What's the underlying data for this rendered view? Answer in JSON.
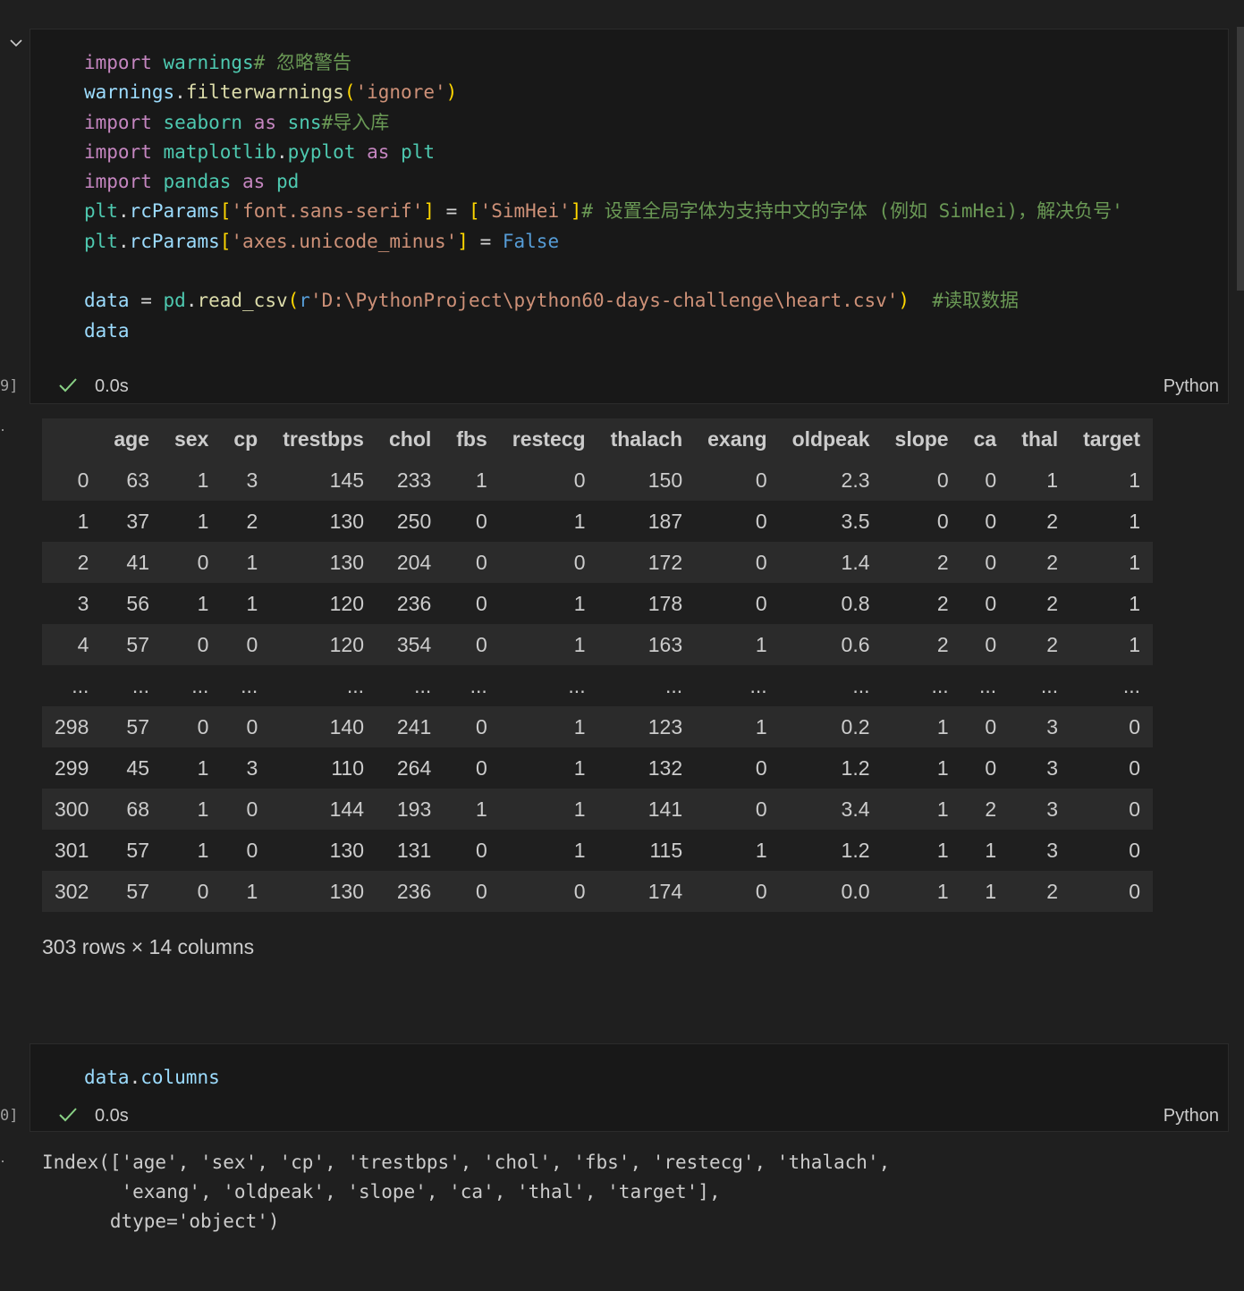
{
  "cells": [
    {
      "exec_count": "9]",
      "time": "0.0s",
      "language": "Python",
      "code_lines": [
        [
          [
            "kw",
            "import"
          ],
          [
            "op",
            " "
          ],
          [
            "mod",
            "warnings"
          ],
          [
            "cmt",
            "# 忽略警告"
          ]
        ],
        [
          [
            "var",
            "warnings"
          ],
          [
            "op",
            "."
          ],
          [
            "fn",
            "filterwarnings"
          ],
          [
            "br1",
            "("
          ],
          [
            "str",
            "'ignore'"
          ],
          [
            "br1",
            ")"
          ]
        ],
        [
          [
            "kw",
            "import"
          ],
          [
            "op",
            " "
          ],
          [
            "mod",
            "seaborn"
          ],
          [
            "op",
            " "
          ],
          [
            "kw",
            "as"
          ],
          [
            "op",
            " "
          ],
          [
            "mod",
            "sns"
          ],
          [
            "cmt",
            "#导入库"
          ]
        ],
        [
          [
            "kw",
            "import"
          ],
          [
            "op",
            " "
          ],
          [
            "mod",
            "matplotlib"
          ],
          [
            "op",
            "."
          ],
          [
            "mod",
            "pyplot"
          ],
          [
            "op",
            " "
          ],
          [
            "kw",
            "as"
          ],
          [
            "op",
            " "
          ],
          [
            "mod",
            "plt"
          ]
        ],
        [
          [
            "kw",
            "import"
          ],
          [
            "op",
            " "
          ],
          [
            "mod",
            "pandas"
          ],
          [
            "op",
            " "
          ],
          [
            "kw",
            "as"
          ],
          [
            "op",
            " "
          ],
          [
            "mod",
            "pd"
          ]
        ],
        [
          [
            "mod",
            "plt"
          ],
          [
            "op",
            "."
          ],
          [
            "var",
            "rcParams"
          ],
          [
            "br1",
            "["
          ],
          [
            "str",
            "'font.sans-serif'"
          ],
          [
            "br1",
            "]"
          ],
          [
            "op",
            " = "
          ],
          [
            "br1",
            "["
          ],
          [
            "str",
            "'SimHei'"
          ],
          [
            "br1",
            "]"
          ],
          [
            "cmt",
            "# 设置全局字体为支持中文的字体 (例如 SimHei)，解决负号'"
          ]
        ],
        [
          [
            "mod",
            "plt"
          ],
          [
            "op",
            "."
          ],
          [
            "var",
            "rcParams"
          ],
          [
            "br1",
            "["
          ],
          [
            "str",
            "'axes.unicode_minus'"
          ],
          [
            "br1",
            "]"
          ],
          [
            "op",
            " = "
          ],
          [
            "const",
            "False"
          ]
        ],
        [],
        [
          [
            "var",
            "data"
          ],
          [
            "op",
            " = "
          ],
          [
            "mod",
            "pd"
          ],
          [
            "op",
            "."
          ],
          [
            "fn",
            "read_csv"
          ],
          [
            "br1",
            "("
          ],
          [
            "const",
            "r"
          ],
          [
            "str",
            "'D:\\PythonProject\\python60-days-challenge\\heart.csv'"
          ],
          [
            "br1",
            ")"
          ],
          [
            "op",
            "  "
          ],
          [
            "cmt",
            "#读取数据"
          ]
        ],
        [
          [
            "var",
            "data"
          ]
        ]
      ]
    },
    {
      "exec_count": "0]",
      "time": "0.0s",
      "language": "Python",
      "code_lines": [
        [
          [
            "var",
            "data"
          ],
          [
            "op",
            "."
          ],
          [
            "var",
            "columns"
          ]
        ]
      ]
    }
  ],
  "dataframe": {
    "columns": [
      "",
      "age",
      "sex",
      "cp",
      "trestbps",
      "chol",
      "fbs",
      "restecg",
      "thalach",
      "exang",
      "oldpeak",
      "slope",
      "ca",
      "thal",
      "target"
    ],
    "rows": [
      [
        "0",
        "63",
        "1",
        "3",
        "145",
        "233",
        "1",
        "0",
        "150",
        "0",
        "2.3",
        "0",
        "0",
        "1",
        "1"
      ],
      [
        "1",
        "37",
        "1",
        "2",
        "130",
        "250",
        "0",
        "1",
        "187",
        "0",
        "3.5",
        "0",
        "0",
        "2",
        "1"
      ],
      [
        "2",
        "41",
        "0",
        "1",
        "130",
        "204",
        "0",
        "0",
        "172",
        "0",
        "1.4",
        "2",
        "0",
        "2",
        "1"
      ],
      [
        "3",
        "56",
        "1",
        "1",
        "120",
        "236",
        "0",
        "1",
        "178",
        "0",
        "0.8",
        "2",
        "0",
        "2",
        "1"
      ],
      [
        "4",
        "57",
        "0",
        "0",
        "120",
        "354",
        "0",
        "1",
        "163",
        "1",
        "0.6",
        "2",
        "0",
        "2",
        "1"
      ],
      [
        "...",
        "...",
        "...",
        "...",
        "...",
        "...",
        "...",
        "...",
        "...",
        "...",
        "...",
        "...",
        "...",
        "...",
        "..."
      ],
      [
        "298",
        "57",
        "0",
        "0",
        "140",
        "241",
        "0",
        "1",
        "123",
        "1",
        "0.2",
        "1",
        "0",
        "3",
        "0"
      ],
      [
        "299",
        "45",
        "1",
        "3",
        "110",
        "264",
        "0",
        "1",
        "132",
        "0",
        "1.2",
        "1",
        "0",
        "3",
        "0"
      ],
      [
        "300",
        "68",
        "1",
        "0",
        "144",
        "193",
        "1",
        "1",
        "141",
        "0",
        "3.4",
        "1",
        "2",
        "3",
        "0"
      ],
      [
        "301",
        "57",
        "1",
        "0",
        "130",
        "131",
        "0",
        "1",
        "115",
        "1",
        "1.2",
        "1",
        "1",
        "3",
        "0"
      ],
      [
        "302",
        "57",
        "0",
        "1",
        "130",
        "236",
        "0",
        "0",
        "174",
        "0",
        "0.0",
        "1",
        "1",
        "2",
        "0"
      ]
    ],
    "shape_text": "303 rows × 14 columns"
  },
  "columns_output": "Index(['age', 'sex', 'cp', 'trestbps', 'chol', 'fbs', 'restecg', 'thalach',\n       'exang', 'oldpeak', 'slope', 'ca', 'thal', 'target'],\n      dtype='object')",
  "output_marker": "·",
  "colors": {
    "background": "#1f1f1f",
    "cell_bg": "#181818",
    "check": "#89d185"
  }
}
